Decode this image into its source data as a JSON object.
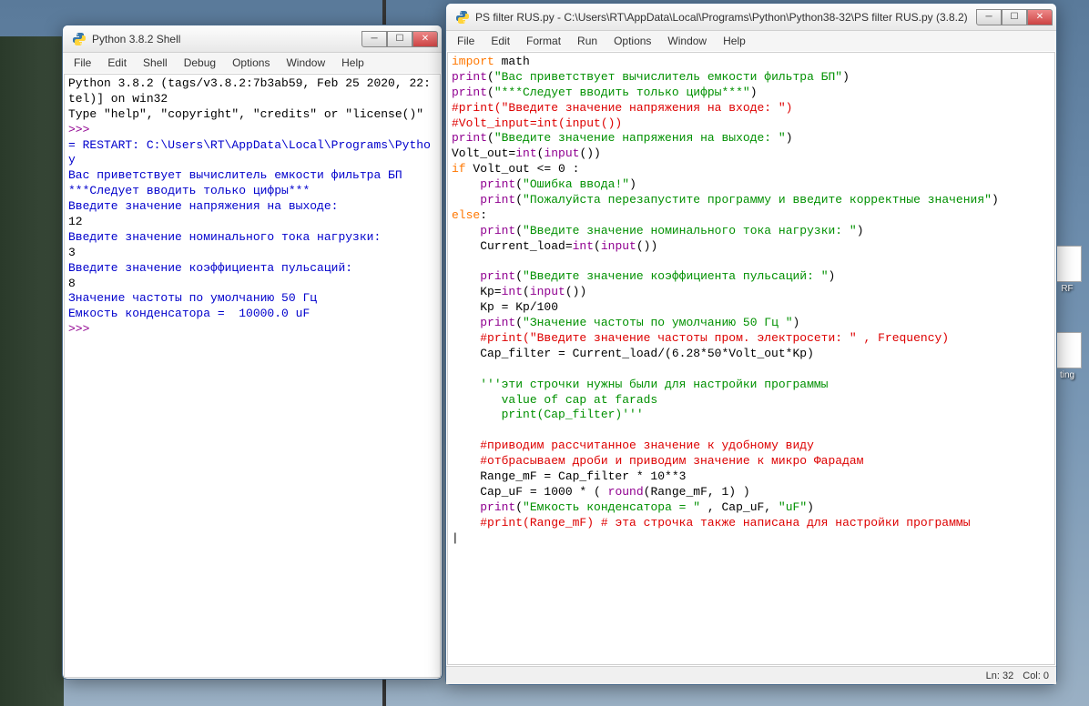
{
  "shell_window": {
    "title": "Python 3.8.2 Shell",
    "menu": [
      "File",
      "Edit",
      "Shell",
      "Debug",
      "Options",
      "Window",
      "Help"
    ],
    "lines": [
      {
        "cls": "t-black",
        "text": "Python 3.8.2 (tags/v3.8.2:7b3ab59, Feb 25 2020, 22:"
      },
      {
        "cls": "t-black",
        "text": "tel)] on win32"
      },
      {
        "cls": "t-black",
        "text": "Type \"help\", \"copyright\", \"credits\" or \"license()\" "
      },
      {
        "cls": "t-prompt",
        "text": ">>> "
      },
      {
        "cls": "t-blue",
        "text": "= RESTART: C:\\Users\\RT\\AppData\\Local\\Programs\\Pytho"
      },
      {
        "cls": "t-blue",
        "text": "y"
      },
      {
        "cls": "t-blue",
        "text": "Вас приветствует вычислитель емкости фильтра БП"
      },
      {
        "cls": "t-blue",
        "text": "***Следует вводить только цифры***"
      },
      {
        "cls": "t-blue",
        "text": "Введите значение напряжения на выходе: "
      },
      {
        "cls": "t-black",
        "text": "12"
      },
      {
        "cls": "t-blue",
        "text": "Введите значение номинального тока нагрузки: "
      },
      {
        "cls": "t-black",
        "text": "3"
      },
      {
        "cls": "t-blue",
        "text": "Введите значение коэффициента пульсаций: "
      },
      {
        "cls": "t-black",
        "text": "8"
      },
      {
        "cls": "t-blue",
        "text": "Значение частоты по умолчанию 50 Гц "
      },
      {
        "cls": "t-blue",
        "text": "Емкость конденсатора =  10000.0 uF"
      },
      {
        "cls": "t-prompt",
        "text": ">>> "
      }
    ]
  },
  "editor_window": {
    "title": "PS filter RUS.py - C:\\Users\\RT\\AppData\\Local\\Programs\\Python\\Python38-32\\PS filter RUS.py (3.8.2)",
    "menu": [
      "File",
      "Edit",
      "Format",
      "Run",
      "Options",
      "Window",
      "Help"
    ],
    "status": {
      "line": "Ln: 32",
      "col": "Col: 0"
    },
    "code": [
      [
        {
          "c": "t-orange",
          "t": "import"
        },
        {
          "c": "t-black",
          "t": " math"
        }
      ],
      [
        {
          "c": "t-purple",
          "t": "print"
        },
        {
          "c": "t-black",
          "t": "("
        },
        {
          "c": "t-green",
          "t": "\"Вас приветствует вычислитель емкости фильтра БП\""
        },
        {
          "c": "t-black",
          "t": ")"
        }
      ],
      [
        {
          "c": "t-purple",
          "t": "print"
        },
        {
          "c": "t-black",
          "t": "("
        },
        {
          "c": "t-green",
          "t": "\"***Следует вводить только цифры***\""
        },
        {
          "c": "t-black",
          "t": ")"
        }
      ],
      [
        {
          "c": "t-red",
          "t": "#print(\"Введите значение напряжения на входе: \")"
        }
      ],
      [
        {
          "c": "t-red",
          "t": "#Volt_input=int(input())"
        }
      ],
      [
        {
          "c": "t-purple",
          "t": "print"
        },
        {
          "c": "t-black",
          "t": "("
        },
        {
          "c": "t-green",
          "t": "\"Введите значение напряжения на выходе: \""
        },
        {
          "c": "t-black",
          "t": ")"
        }
      ],
      [
        {
          "c": "t-black",
          "t": "Volt_out="
        },
        {
          "c": "t-purple",
          "t": "int"
        },
        {
          "c": "t-black",
          "t": "("
        },
        {
          "c": "t-purple",
          "t": "input"
        },
        {
          "c": "t-black",
          "t": "())"
        }
      ],
      [
        {
          "c": "t-orange",
          "t": "if"
        },
        {
          "c": "t-black",
          "t": " Volt_out <= "
        },
        {
          "c": "t-black",
          "t": "0"
        },
        {
          "c": "t-black",
          "t": " :"
        }
      ],
      [
        {
          "c": "t-black",
          "t": "    "
        },
        {
          "c": "t-purple",
          "t": "print"
        },
        {
          "c": "t-black",
          "t": "("
        },
        {
          "c": "t-green",
          "t": "\"Ошибка ввода!\""
        },
        {
          "c": "t-black",
          "t": ")"
        }
      ],
      [
        {
          "c": "t-black",
          "t": "    "
        },
        {
          "c": "t-purple",
          "t": "print"
        },
        {
          "c": "t-black",
          "t": "("
        },
        {
          "c": "t-green",
          "t": "\"Пожалуйста перезапустите программу и введите корректные значения\""
        },
        {
          "c": "t-black",
          "t": ")"
        }
      ],
      [
        {
          "c": "t-orange",
          "t": "else"
        },
        {
          "c": "t-black",
          "t": ":"
        }
      ],
      [
        {
          "c": "t-black",
          "t": "    "
        },
        {
          "c": "t-purple",
          "t": "print"
        },
        {
          "c": "t-black",
          "t": "("
        },
        {
          "c": "t-green",
          "t": "\"Введите значение номинального тока нагрузки: \""
        },
        {
          "c": "t-black",
          "t": ")"
        }
      ],
      [
        {
          "c": "t-black",
          "t": "    Current_load="
        },
        {
          "c": "t-purple",
          "t": "int"
        },
        {
          "c": "t-black",
          "t": "("
        },
        {
          "c": "t-purple",
          "t": "input"
        },
        {
          "c": "t-black",
          "t": "())"
        }
      ],
      [
        {
          "c": "t-black",
          "t": ""
        }
      ],
      [
        {
          "c": "t-black",
          "t": "    "
        },
        {
          "c": "t-purple",
          "t": "print"
        },
        {
          "c": "t-black",
          "t": "("
        },
        {
          "c": "t-green",
          "t": "\"Введите значение коэффициента пульсаций: \""
        },
        {
          "c": "t-black",
          "t": ")"
        }
      ],
      [
        {
          "c": "t-black",
          "t": "    Kp="
        },
        {
          "c": "t-purple",
          "t": "int"
        },
        {
          "c": "t-black",
          "t": "("
        },
        {
          "c": "t-purple",
          "t": "input"
        },
        {
          "c": "t-black",
          "t": "())"
        }
      ],
      [
        {
          "c": "t-black",
          "t": "    Kp = Kp/100"
        }
      ],
      [
        {
          "c": "t-black",
          "t": "    "
        },
        {
          "c": "t-purple",
          "t": "print"
        },
        {
          "c": "t-black",
          "t": "("
        },
        {
          "c": "t-green",
          "t": "\"Значение частоты по умолчанию 50 Гц \""
        },
        {
          "c": "t-black",
          "t": ")"
        }
      ],
      [
        {
          "c": "t-black",
          "t": "    "
        },
        {
          "c": "t-red",
          "t": "#print(\"Введите значение частоты пром. электросети: \" , Frequency)"
        }
      ],
      [
        {
          "c": "t-black",
          "t": "    Cap_filter = Current_load/(6.28*50*Volt_out*Kp)"
        }
      ],
      [
        {
          "c": "t-black",
          "t": ""
        }
      ],
      [
        {
          "c": "t-black",
          "t": "    "
        },
        {
          "c": "t-green",
          "t": "'''эти строчки нужны были для настройки программы"
        }
      ],
      [
        {
          "c": "t-green",
          "t": "       value of cap at farads"
        }
      ],
      [
        {
          "c": "t-green",
          "t": "       print(Cap_filter)'''"
        }
      ],
      [
        {
          "c": "t-black",
          "t": ""
        }
      ],
      [
        {
          "c": "t-black",
          "t": "    "
        },
        {
          "c": "t-red",
          "t": "#приводим рассчитанное значение к удобному виду"
        }
      ],
      [
        {
          "c": "t-black",
          "t": "    "
        },
        {
          "c": "t-red",
          "t": "#отбрасываем дроби и приводим значение к микро Фарадам"
        }
      ],
      [
        {
          "c": "t-black",
          "t": "    Range_mF = Cap_filter * 10**3"
        }
      ],
      [
        {
          "c": "t-black",
          "t": "    Cap_uF = 1000 * ( "
        },
        {
          "c": "t-purple",
          "t": "round"
        },
        {
          "c": "t-black",
          "t": "(Range_mF, 1) )"
        }
      ],
      [
        {
          "c": "t-black",
          "t": "    "
        },
        {
          "c": "t-purple",
          "t": "print"
        },
        {
          "c": "t-black",
          "t": "("
        },
        {
          "c": "t-green",
          "t": "\"Емкость конденсатора = \""
        },
        {
          "c": "t-black",
          "t": " , Cap_uF, "
        },
        {
          "c": "t-green",
          "t": "\"uF\""
        },
        {
          "c": "t-black",
          "t": ")"
        }
      ],
      [
        {
          "c": "t-black",
          "t": "    "
        },
        {
          "c": "t-red",
          "t": "#print(Range_mF) # эта строчка также написана для настройки программы"
        }
      ]
    ]
  },
  "desktop_icons": [
    {
      "label": "RF"
    },
    {
      "label": "ting"
    }
  ]
}
